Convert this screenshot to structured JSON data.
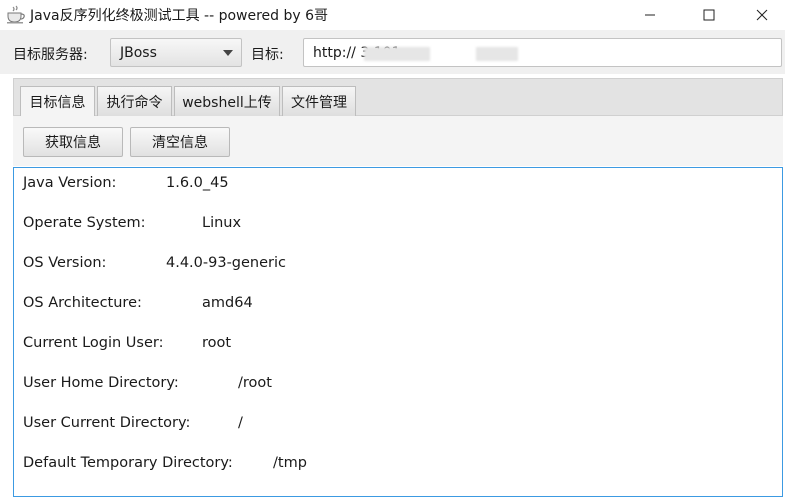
{
  "window": {
    "title": "Java反序列化终极测试工具  -- powered by 6哥",
    "icons": {
      "app": "coffee-cup-icon",
      "minimize": "minimize-icon",
      "maximize": "maximize-icon",
      "close": "close-icon"
    }
  },
  "toolbar": {
    "server_label": "目标服务器:",
    "server_selected": "JBoss",
    "target_label": "目标:",
    "target_value": "http://           3.101"
  },
  "tabs": [
    {
      "label": "目标信息",
      "active": true
    },
    {
      "label": "执行命令",
      "active": false
    },
    {
      "label": "webshell上传",
      "active": false
    },
    {
      "label": "文件管理",
      "active": false
    }
  ],
  "actions": {
    "get_info": "获取信息",
    "clear_info": "清空信息"
  },
  "info": [
    {
      "key": "Java Version:",
      "value": "1.6.0_45"
    },
    {
      "key": "Operate System:",
      "value": "Linux"
    },
    {
      "key": "OS Version:",
      "value": "4.4.0-93-generic"
    },
    {
      "key": "OS Architecture:",
      "value": "amd64"
    },
    {
      "key": "Current Login User:",
      "value": "root"
    },
    {
      "key": "User Home Directory:",
      "value": "/root"
    },
    {
      "key": "User Current Directory:",
      "value": "/"
    },
    {
      "key": "Default Temporary Directory:",
      "value": "/tmp"
    }
  ],
  "colors": {
    "focus_border": "#3c9ae2",
    "toolbar_bg": "#f0f0f0"
  }
}
